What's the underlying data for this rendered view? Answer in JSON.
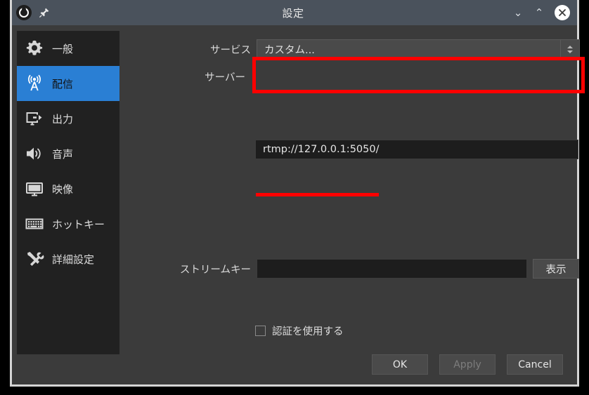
{
  "window": {
    "title": "設定",
    "logo_icon": "obs-logo-icon",
    "pin_icon": "pin-icon",
    "minimize_label": "⌄",
    "maximize_label": "⌃",
    "close_icon": "close-icon"
  },
  "sidebar": {
    "items": [
      {
        "label": "一般",
        "icon": "gear-icon",
        "selected": false
      },
      {
        "label": "配信",
        "icon": "broadcast-icon",
        "selected": true
      },
      {
        "label": "出力",
        "icon": "output-icon",
        "selected": false
      },
      {
        "label": "音声",
        "icon": "speaker-icon",
        "selected": false
      },
      {
        "label": "映像",
        "icon": "monitor-icon",
        "selected": false
      },
      {
        "label": "ホットキー",
        "icon": "keyboard-icon",
        "selected": false
      },
      {
        "label": "詳細設定",
        "icon": "tools-icon",
        "selected": false
      }
    ]
  },
  "form": {
    "service_label": "サービス",
    "service_value": "カスタム...",
    "service_spinner_icon": "updown-chevron-icon",
    "server_label": "サーバー",
    "server_value": "rtmp://127.0.0.1:5050/",
    "stream_key_label": "ストリームキー",
    "stream_key_value": "",
    "stream_key_placeholder": "",
    "show_button_label": "表示",
    "auth_checkbox_label": "認証を使用する",
    "auth_checked": false
  },
  "footer": {
    "ok_label": "OK",
    "apply_label": "Apply",
    "apply_disabled": true,
    "cancel_label": "Cancel"
  },
  "annotations": {
    "highlight_color": "#ff0000",
    "service_row_box": "red-rectangle-around-service-dropdown",
    "server_underline": "red-underline-under-server-url"
  }
}
